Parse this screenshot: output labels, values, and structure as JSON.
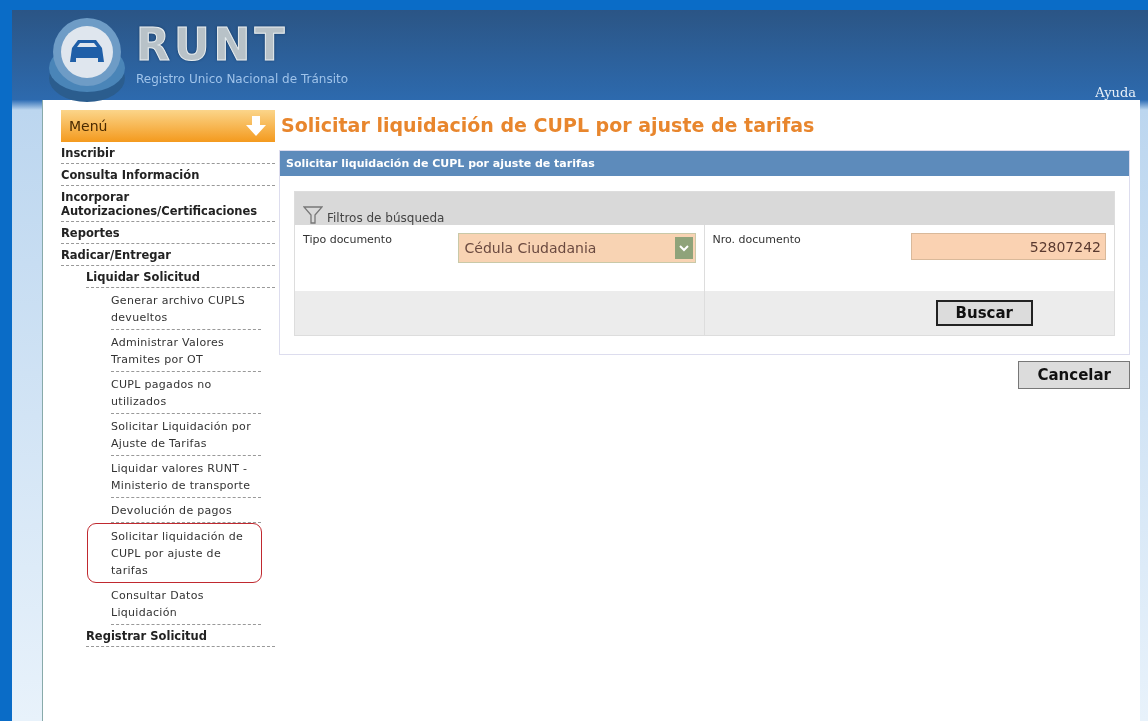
{
  "header": {
    "logo_text": "RUNT",
    "subtitle": "Registro Unico Nacional de Tránsito",
    "help_link": "Ayuda"
  },
  "menu": {
    "title": "Menú",
    "items": [
      {
        "label": "Inscribir",
        "selected": false
      },
      {
        "label": "Consulta Información",
        "selected": false
      },
      {
        "label": "Incorporar Autorizaciones/Certificaciones",
        "selected": false
      },
      {
        "label": "Reportes",
        "selected": false
      },
      {
        "label": "Radicar/Entregar",
        "selected": false,
        "children": [
          {
            "label": "Liquidar Solicitud",
            "selected": false,
            "children": [
              {
                "label": "Generar archivo CUPLS devueltos",
                "selected": false
              },
              {
                "label": "Administrar Valores Tramites por OT",
                "selected": false
              },
              {
                "label": "CUPL pagados no utilizados",
                "selected": false
              },
              {
                "label": "Solicitar Liquidación por Ajuste de Tarifas",
                "selected": false
              },
              {
                "label": "Liquidar valores RUNT - Ministerio de transporte",
                "selected": false
              },
              {
                "label": "Devolución de pagos",
                "selected": false
              },
              {
                "label": "Solicitar liquidación de CUPL por ajuste de tarifas",
                "selected": true
              },
              {
                "label": "Consultar Datos Liquidación",
                "selected": false
              }
            ]
          },
          {
            "label": "Registrar Solicitud",
            "selected": false
          }
        ]
      }
    ]
  },
  "page_title": "Solicitar liquidación de CUPL por ajuste de tarifas",
  "panel": {
    "title": "Solicitar liquidación de CUPL por ajuste de tarifas",
    "filters": {
      "title": "Filtros de búsqueda",
      "document_type": {
        "label": "Tipo documento",
        "value": "Cédula Ciudadania"
      },
      "document_number": {
        "label": "Nro. documento",
        "value": "52807242"
      },
      "search_button": "Buscar"
    }
  },
  "cancel_button": "Cancelar"
}
